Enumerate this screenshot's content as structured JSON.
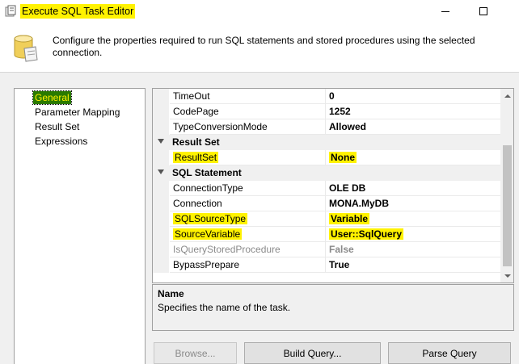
{
  "window": {
    "title": "Execute SQL Task Editor",
    "icon": "execute-sql-task-icon"
  },
  "header": {
    "description": "Configure the properties required to run SQL statements and stored procedures using the selected connection.",
    "icon": "database-scroll-icon"
  },
  "nav": {
    "items": [
      {
        "label": "General",
        "selected": true
      },
      {
        "label": "Parameter Mapping",
        "selected": false
      },
      {
        "label": "Result Set",
        "selected": false
      },
      {
        "label": "Expressions",
        "selected": false
      }
    ]
  },
  "grid": {
    "rows": [
      {
        "name": "TimeOut",
        "value": "0"
      },
      {
        "name": "CodePage",
        "value": "1252"
      },
      {
        "name": "TypeConversionMode",
        "value": "Allowed"
      },
      {
        "category": "Result Set"
      },
      {
        "name": "ResultSet",
        "value": "None",
        "highlight": true
      },
      {
        "category": "SQL Statement"
      },
      {
        "name": "ConnectionType",
        "value": "OLE DB"
      },
      {
        "name": "Connection",
        "value": "MONA.MyDB"
      },
      {
        "name": "SQLSourceType",
        "value": "Variable",
        "highlight": true
      },
      {
        "name": "SourceVariable",
        "value": "User::SqlQuery",
        "highlight": true
      },
      {
        "name": "IsQueryStoredProcedure",
        "value": "False",
        "disabled": true
      },
      {
        "name": "BypassPrepare",
        "value": "True"
      }
    ]
  },
  "description": {
    "title": "Name",
    "text": "Specifies the name of the task."
  },
  "buttons": {
    "browse": "Browse...",
    "build_query": "Build Query...",
    "parse_query": "Parse Query"
  },
  "colors": {
    "highlight": "#fff200",
    "selected_nav_bg": "#2a7a00"
  }
}
